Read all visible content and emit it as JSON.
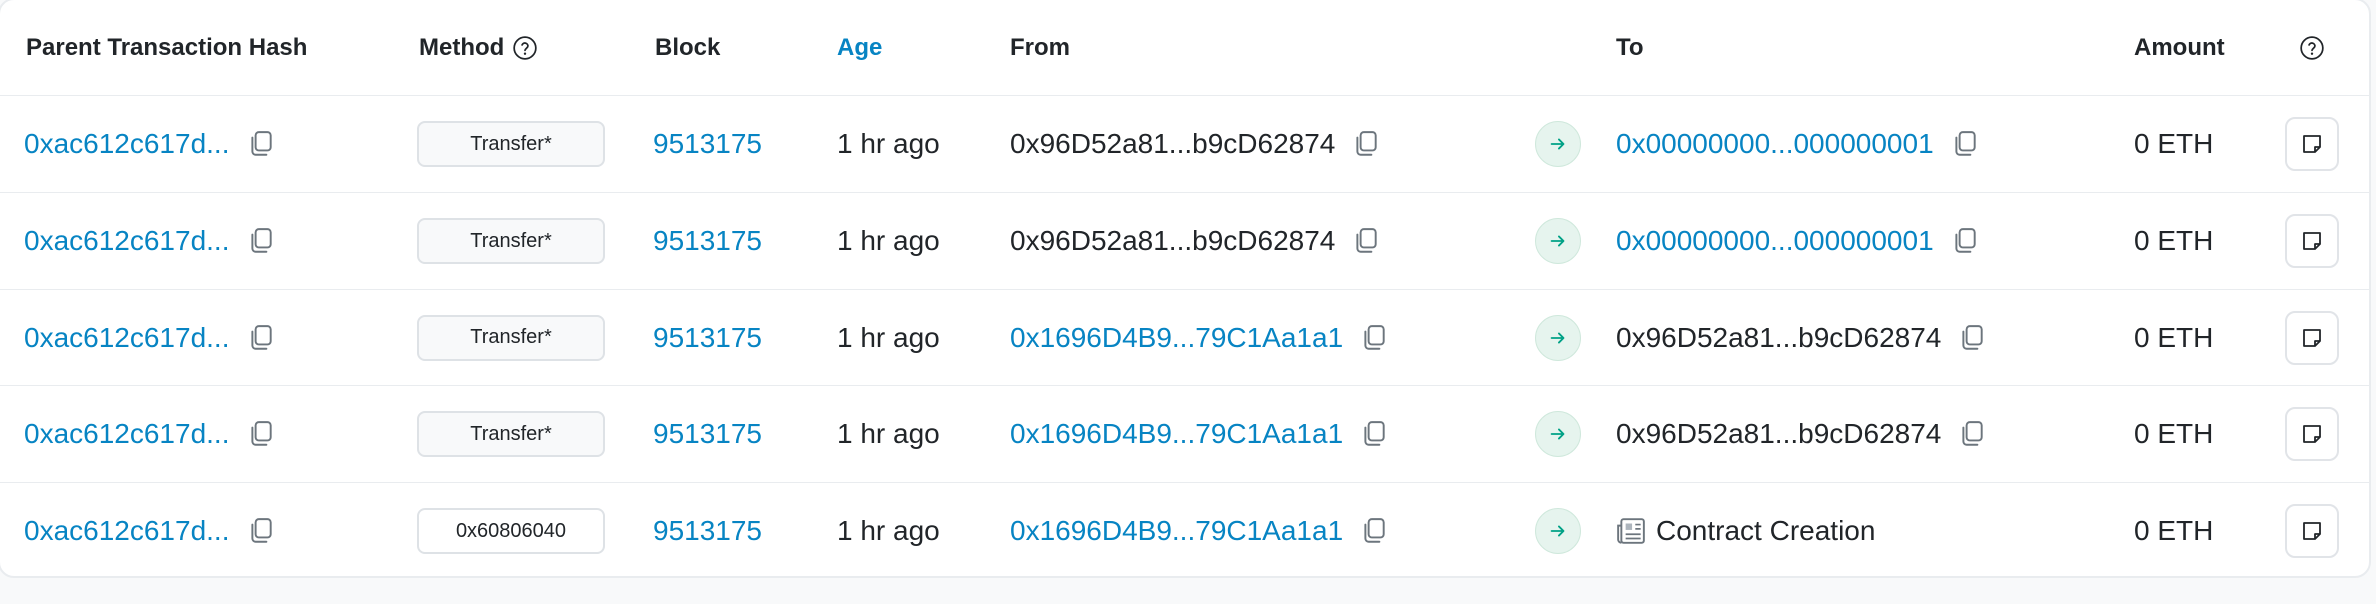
{
  "headers": {
    "parent_hash": "Parent Transaction Hash",
    "method": "Method",
    "block": "Block",
    "age": "Age",
    "from": "From",
    "to": "To",
    "amount": "Amount"
  },
  "colors": {
    "link": "#0784c3",
    "text": "#212529",
    "arrow_bg": "#e6f4ee",
    "arrow_fg": "#00a186"
  },
  "rows": [
    {
      "hash": "0xac612c617d...",
      "method": "Transfer*",
      "block": "9513175",
      "age": "1 hr ago",
      "from": "0x96D52a81...b9cD62874",
      "to": "0x00000000...000000001",
      "amount": "0 ETH"
    },
    {
      "hash": "0xac612c617d...",
      "method": "Transfer*",
      "block": "9513175",
      "age": "1 hr ago",
      "from": "0x96D52a81...b9cD62874",
      "to": "0x00000000...000000001",
      "amount": "0 ETH"
    },
    {
      "hash": "0xac612c617d...",
      "method": "Transfer*",
      "block": "9513175",
      "age": "1 hr ago",
      "from": "0x1696D4B9...79C1Aa1a1",
      "to": "0x96D52a81...b9cD62874",
      "amount": "0 ETH"
    },
    {
      "hash": "0xac612c617d...",
      "method": "Transfer*",
      "block": "9513175",
      "age": "1 hr ago",
      "from": "0x1696D4B9...79C1Aa1a1",
      "to": "0x96D52a81...b9cD62874",
      "amount": "0 ETH"
    },
    {
      "hash": "0xac612c617d...",
      "method": "0x60806040",
      "block": "9513175",
      "age": "1 hr ago",
      "from": "0x1696D4B9...79C1Aa1a1",
      "to": "Contract Creation",
      "amount": "0 ETH"
    }
  ]
}
